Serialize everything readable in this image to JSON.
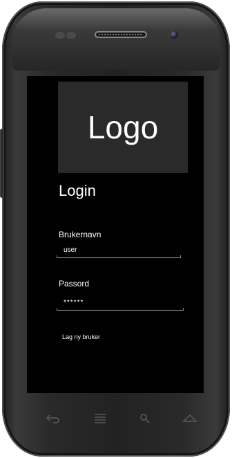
{
  "logo": {
    "text": "Logo"
  },
  "login": {
    "title": "Login",
    "username_label": "Brukernavn",
    "username_value": "user",
    "password_label": "Passord",
    "password_value": "******",
    "create_user_link": "Lag ny bruker"
  },
  "nav": {
    "items": [
      {
        "icon": "back-icon"
      },
      {
        "icon": "menu-icon"
      },
      {
        "icon": "search-icon"
      },
      {
        "icon": "home-icon"
      }
    ]
  },
  "colors": {
    "screen_bg": "#000000",
    "logo_bg": "#2a2a2a",
    "text": "#ffffff"
  }
}
